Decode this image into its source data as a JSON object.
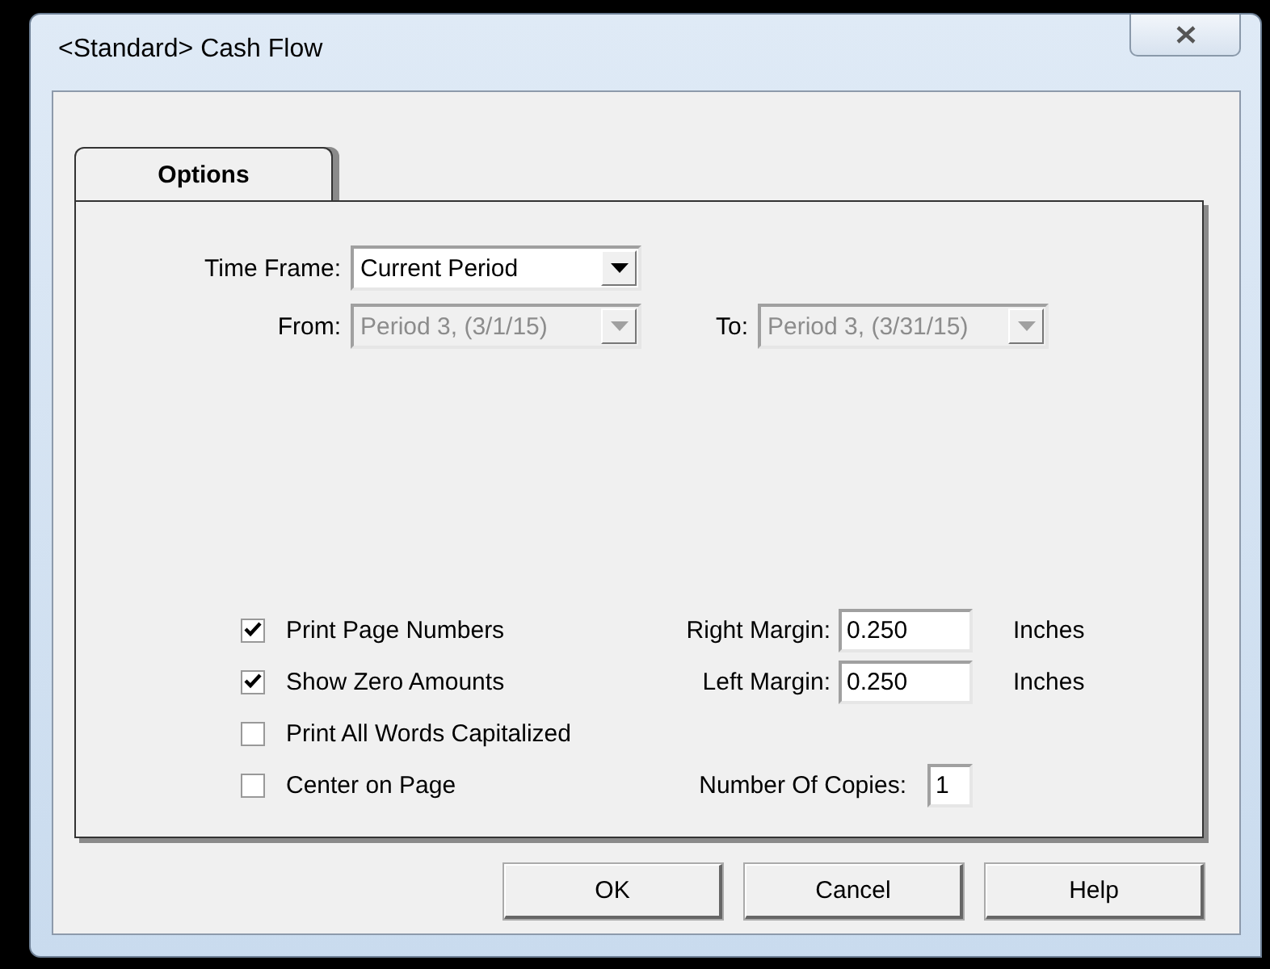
{
  "window": {
    "title": "<Standard> Cash Flow"
  },
  "tabs": [
    {
      "label": "Options",
      "selected": true
    }
  ],
  "time_frame": {
    "label": "Time Frame:",
    "value": "Current Period",
    "disabled": false
  },
  "range": [
    {
      "label": "From:",
      "value": "Period 3, (3/1/15)",
      "disabled": true
    },
    {
      "label": "To:",
      "value": "Period 3, (3/31/15)",
      "disabled": true
    }
  ],
  "checkboxes": [
    {
      "label": "Print Page Numbers",
      "checked": true
    },
    {
      "label": "Show Zero Amounts",
      "checked": true
    },
    {
      "label": "Print All Words Capitalized",
      "checked": false
    },
    {
      "label": "Center on Page",
      "checked": false
    }
  ],
  "margins": [
    {
      "label": "Right Margin:",
      "value": "0.250",
      "unit": "Inches"
    },
    {
      "label": "Left Margin:",
      "value": "0.250",
      "unit": "Inches"
    }
  ],
  "copies": {
    "label": "Number Of Copies:",
    "value": "1"
  },
  "buttons": [
    "OK",
    "Cancel",
    "Help"
  ]
}
